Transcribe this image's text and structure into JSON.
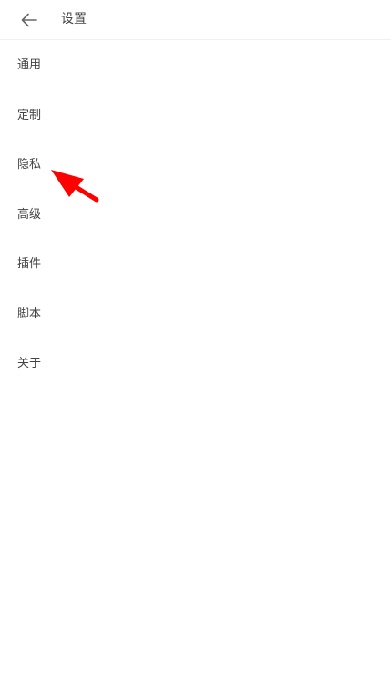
{
  "header": {
    "title": "设置",
    "back_icon": "arrow-left-icon"
  },
  "menu": {
    "items": [
      {
        "id": "general",
        "label": "通用"
      },
      {
        "id": "custom",
        "label": "定制"
      },
      {
        "id": "privacy",
        "label": "隐私"
      },
      {
        "id": "advanced",
        "label": "高级"
      },
      {
        "id": "plugins",
        "label": "插件"
      },
      {
        "id": "scripts",
        "label": "脚本"
      },
      {
        "id": "about",
        "label": "关于"
      }
    ]
  },
  "colors": {
    "background": "#ffffff",
    "text": "#444444",
    "divider": "#f0f0f0",
    "annotation_arrow": "#ff0000"
  }
}
